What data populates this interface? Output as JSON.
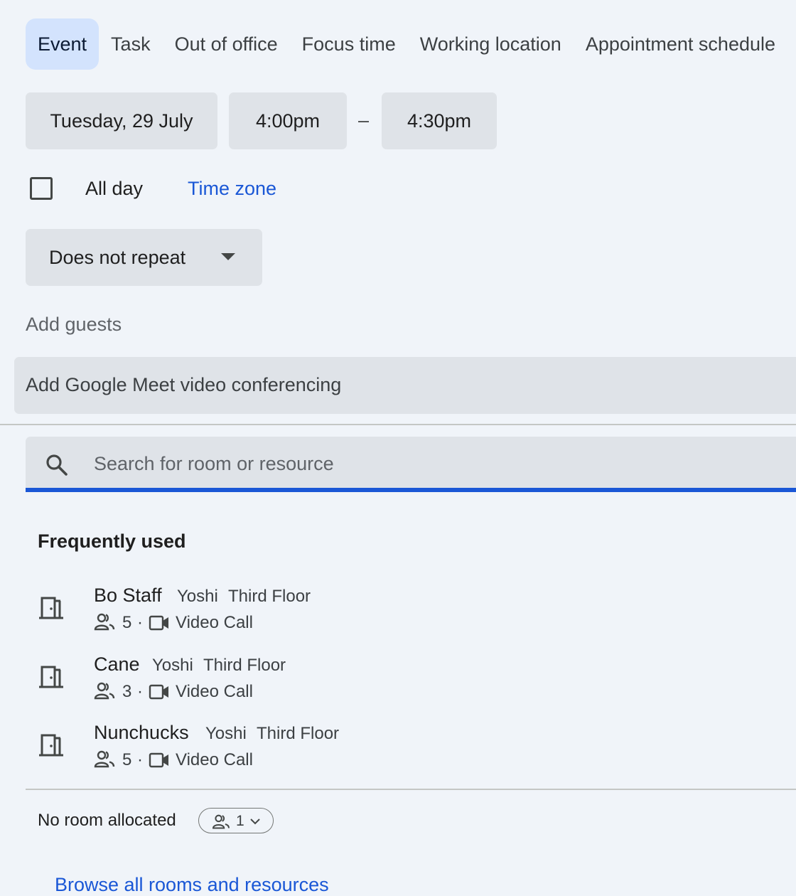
{
  "tabs": [
    {
      "label": "Event",
      "active": true
    },
    {
      "label": "Task"
    },
    {
      "label": "Out of office"
    },
    {
      "label": "Focus time"
    },
    {
      "label": "Working location"
    },
    {
      "label": "Appointment schedule"
    }
  ],
  "datetime": {
    "date": "Tuesday, 29 July",
    "start": "4:00pm",
    "separator": "–",
    "end": "4:30pm"
  },
  "all_day": {
    "label": "All day",
    "checked": false
  },
  "time_zone_link": "Time zone",
  "repeat": {
    "label": "Does not repeat",
    "icon": "dropdown-arrow-icon"
  },
  "add_guests_placeholder": "Add guests",
  "meet_button": "Add Google Meet video conferencing",
  "search": {
    "placeholder": "Search for room or resource",
    "icon": "search-icon"
  },
  "frequently_used": {
    "heading": "Frequently used",
    "rooms": [
      {
        "name": "Bo Staff",
        "building": "Yoshi",
        "floor": "Third Floor",
        "capacity": "5",
        "dot": "·",
        "feature": "Video Call"
      },
      {
        "name": "Cane",
        "building": "Yoshi",
        "floor": "Third Floor",
        "capacity": "3",
        "dot": "·",
        "feature": "Video Call"
      },
      {
        "name": "Nunchucks",
        "building": "Yoshi",
        "floor": "Third Floor",
        "capacity": "5",
        "dot": "·",
        "feature": "Video Call"
      }
    ]
  },
  "no_room": {
    "label": "No room allocated",
    "guest_count": "1"
  },
  "browse_link": "Browse all rooms and resources",
  "colors": {
    "background": "#f0f4f9",
    "field": "#dfe3e8",
    "accent": "#1a57d6",
    "active_tab": "#d3e3fd"
  }
}
